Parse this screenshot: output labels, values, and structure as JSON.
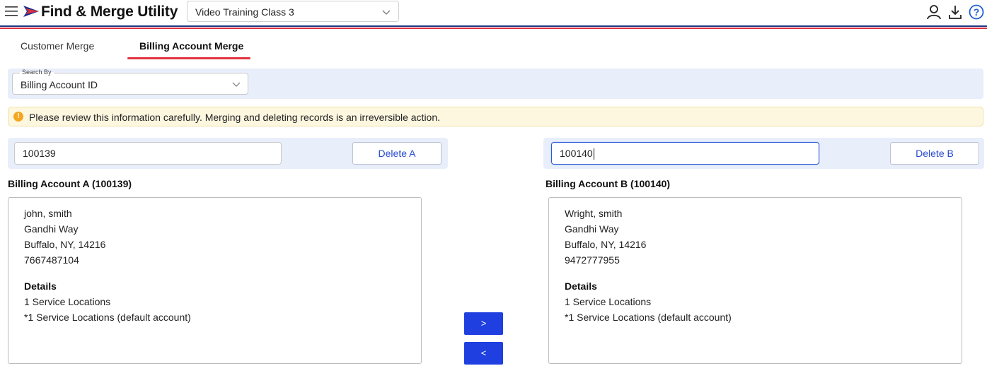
{
  "app": {
    "title": "Find & Merge Utility",
    "class_select": "Video Training Class 3"
  },
  "header_icons": [
    "user-icon",
    "download-icon",
    "help-icon"
  ],
  "tabs": [
    {
      "label": "Customer Merge",
      "active": false
    },
    {
      "label": "Billing Account Merge",
      "active": true
    }
  ],
  "search": {
    "legend": "Search By",
    "value": "Billing Account ID"
  },
  "warning": {
    "text": "Please review this information carefully. Merging and deleting records is an irreversible action."
  },
  "account_a": {
    "id_value": "100139",
    "delete_label": "Delete A",
    "heading": "Billing Account A (100139)",
    "name": "john, smith",
    "street": "Gandhi Way",
    "city": "Buffalo, NY, 14216",
    "phone": "7667487104",
    "details_label": "Details",
    "detail_1": "1 Service Locations",
    "detail_2": "*1 Service Locations (default account)"
  },
  "account_b": {
    "id_value": "100140",
    "delete_label": "Delete B",
    "heading": "Billing Account B (100140)",
    "name": "Wright, smith",
    "street": "Gandhi Way",
    "city": "Buffalo, NY, 14216",
    "phone": "9472777955",
    "details_label": "Details",
    "detail_1": "1 Service Locations",
    "detail_2": "*1 Service Locations (default account)"
  },
  "move": {
    "right_label": ">",
    "left_label": "<"
  },
  "colors": {
    "accent_blue": "#1f3fe0",
    "tab_underline": "#e0323f",
    "panel_bg": "#e9eefb",
    "warning_bg": "#fdf7e0"
  }
}
